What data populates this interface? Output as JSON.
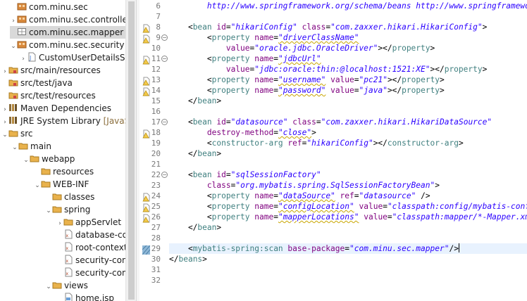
{
  "explorer": {
    "items": [
      {
        "indent": 12,
        "twisty": "",
        "icon": "package-icon",
        "label": "com.minu.sec",
        "extra": "",
        "selected": false
      },
      {
        "indent": 12,
        "twisty": "›",
        "icon": "package-icon",
        "label": "com.minu.sec.controller",
        "extra": "",
        "selected": false
      },
      {
        "indent": 12,
        "twisty": "",
        "icon": "empty-package-icon",
        "label": "com.minu.sec.mapper",
        "extra": "",
        "selected": true
      },
      {
        "indent": 12,
        "twisty": "⌄",
        "icon": "package-icon",
        "label": "com.minu.sec.security",
        "extra": "",
        "selected": false
      },
      {
        "indent": 26,
        "twisty": "›",
        "icon": "java-file-icon",
        "label": "CustomUserDetailsSe",
        "extra": "",
        "selected": false
      },
      {
        "indent": 0,
        "twisty": "›",
        "icon": "source-folder-icon",
        "label": "src/main/resources",
        "extra": "",
        "selected": false
      },
      {
        "indent": 0,
        "twisty": "",
        "icon": "source-folder-icon",
        "label": "src/test/java",
        "extra": "",
        "selected": false
      },
      {
        "indent": 0,
        "twisty": "",
        "icon": "source-folder-icon",
        "label": "src/test/resources",
        "extra": "",
        "selected": false
      },
      {
        "indent": 0,
        "twisty": "›",
        "icon": "library-icon",
        "label": "Maven Dependencies",
        "extra": "",
        "selected": false
      },
      {
        "indent": 0,
        "twisty": "›",
        "icon": "library-icon",
        "label": "JRE System Library",
        "extra": "[JavaSE-",
        "selected": false
      },
      {
        "indent": 0,
        "twisty": "⌄",
        "icon": "folder-icon",
        "label": "src",
        "extra": "",
        "selected": false
      },
      {
        "indent": 14,
        "twisty": "⌄",
        "icon": "folder-icon",
        "label": "main",
        "extra": "",
        "selected": false
      },
      {
        "indent": 30,
        "twisty": "⌄",
        "icon": "folder-icon",
        "label": "webapp",
        "extra": "",
        "selected": false
      },
      {
        "indent": 46,
        "twisty": "",
        "icon": "folder-icon",
        "label": "resources",
        "extra": "",
        "selected": false
      },
      {
        "indent": 46,
        "twisty": "⌄",
        "icon": "folder-icon",
        "label": "WEB-INF",
        "extra": "",
        "selected": false
      },
      {
        "indent": 62,
        "twisty": "",
        "icon": "folder-icon",
        "label": "classes",
        "extra": "",
        "selected": false
      },
      {
        "indent": 62,
        "twisty": "⌄",
        "icon": "folder-icon",
        "label": "spring",
        "extra": "",
        "selected": false
      },
      {
        "indent": 78,
        "twisty": "›",
        "icon": "folder-icon",
        "label": "appServlet",
        "extra": "",
        "selected": false
      },
      {
        "indent": 78,
        "twisty": "",
        "icon": "xml-file-icon",
        "label": "database-co",
        "extra": "",
        "selected": false
      },
      {
        "indent": 78,
        "twisty": "",
        "icon": "xml-file-icon",
        "label": "root-context",
        "extra": "",
        "selected": false
      },
      {
        "indent": 78,
        "twisty": "",
        "icon": "xml-file-icon",
        "label": "security-con",
        "extra": "",
        "selected": false
      },
      {
        "indent": 78,
        "twisty": "",
        "icon": "xml-file-icon",
        "label": "security-con",
        "extra": "",
        "selected": false
      },
      {
        "indent": 62,
        "twisty": "⌄",
        "icon": "folder-icon",
        "label": "views",
        "extra": "",
        "selected": false
      },
      {
        "indent": 78,
        "twisty": "",
        "icon": "jsp-file-icon",
        "label": "home.jsp",
        "extra": "",
        "selected": false
      }
    ]
  },
  "editor": {
    "lines": [
      {
        "n": "6",
        "marker": "",
        "fold": false,
        "hl": false,
        "tokens": [
          [
            "p",
            "        "
          ],
          [
            "v",
            "http://www.springframework.org/schema/beans http://www.springframework.org/schema/beans/spring-beans.xsd\">"
          ]
        ]
      },
      {
        "n": "7",
        "marker": "",
        "fold": false,
        "hl": false,
        "tokens": []
      },
      {
        "n": "8",
        "marker": "warning",
        "fold": false,
        "hl": false,
        "tokens": [
          [
            "p",
            "    <"
          ],
          [
            "t",
            "bean"
          ],
          [
            "p",
            " "
          ],
          [
            "a",
            "id"
          ],
          [
            "p",
            "="
          ],
          [
            "v",
            "\"hikariConfig\""
          ],
          [
            "p",
            " "
          ],
          [
            "a",
            "class"
          ],
          [
            "p",
            "="
          ],
          [
            "v",
            "\"com.zaxxer.hikari.HikariConfig\""
          ],
          [
            "p",
            ">"
          ]
        ]
      },
      {
        "n": "9",
        "marker": "warning",
        "fold": true,
        "hl": false,
        "tokens": [
          [
            "p",
            "        <"
          ],
          [
            "t",
            "property"
          ],
          [
            "p",
            " "
          ],
          [
            "a",
            "name"
          ],
          [
            "p",
            "="
          ],
          [
            "vs",
            "\"driverClassName\""
          ]
        ]
      },
      {
        "n": "10",
        "marker": "",
        "fold": false,
        "hl": false,
        "tokens": [
          [
            "p",
            "            "
          ],
          [
            "a",
            "value"
          ],
          [
            "p",
            "="
          ],
          [
            "v",
            "\"oracle.jdbc.OracleDriver\""
          ],
          [
            "p",
            "></"
          ],
          [
            "t",
            "property"
          ],
          [
            "p",
            ">"
          ]
        ]
      },
      {
        "n": "11",
        "marker": "warning",
        "fold": true,
        "hl": false,
        "tokens": [
          [
            "p",
            "        <"
          ],
          [
            "t",
            "property"
          ],
          [
            "p",
            " "
          ],
          [
            "a",
            "name"
          ],
          [
            "p",
            "="
          ],
          [
            "vs",
            "\"jdbcUrl\""
          ]
        ]
      },
      {
        "n": "12",
        "marker": "",
        "fold": false,
        "hl": false,
        "tokens": [
          [
            "p",
            "            "
          ],
          [
            "a",
            "value"
          ],
          [
            "p",
            "="
          ],
          [
            "v",
            "\"jdbc:oracle:thin:@localhost:1521:XE\""
          ],
          [
            "p",
            "></"
          ],
          [
            "t",
            "property"
          ],
          [
            "p",
            ">"
          ]
        ]
      },
      {
        "n": "13",
        "marker": "warning",
        "fold": false,
        "hl": false,
        "tokens": [
          [
            "p",
            "        <"
          ],
          [
            "t",
            "property"
          ],
          [
            "p",
            " "
          ],
          [
            "a",
            "name"
          ],
          [
            "p",
            "="
          ],
          [
            "vs",
            "\"username\""
          ],
          [
            "p",
            " "
          ],
          [
            "a",
            "value"
          ],
          [
            "p",
            "="
          ],
          [
            "v",
            "\"pc21\""
          ],
          [
            "p",
            "></"
          ],
          [
            "t",
            "property"
          ],
          [
            "p",
            ">"
          ]
        ]
      },
      {
        "n": "14",
        "marker": "warning",
        "fold": false,
        "hl": false,
        "tokens": [
          [
            "p",
            "        <"
          ],
          [
            "t",
            "property"
          ],
          [
            "p",
            " "
          ],
          [
            "a",
            "name"
          ],
          [
            "p",
            "="
          ],
          [
            "vs",
            "\"password\""
          ],
          [
            "p",
            " "
          ],
          [
            "a",
            "value"
          ],
          [
            "p",
            "="
          ],
          [
            "v",
            "\"java\""
          ],
          [
            "p",
            "></"
          ],
          [
            "t",
            "property"
          ],
          [
            "p",
            ">"
          ]
        ]
      },
      {
        "n": "15",
        "marker": "",
        "fold": false,
        "hl": false,
        "tokens": [
          [
            "p",
            "    </"
          ],
          [
            "t",
            "bean"
          ],
          [
            "p",
            ">"
          ]
        ]
      },
      {
        "n": "16",
        "marker": "",
        "fold": false,
        "hl": false,
        "tokens": []
      },
      {
        "n": "17",
        "marker": "",
        "fold": true,
        "hl": false,
        "tokens": [
          [
            "p",
            "    <"
          ],
          [
            "t",
            "bean"
          ],
          [
            "p",
            " "
          ],
          [
            "a",
            "id"
          ],
          [
            "p",
            "="
          ],
          [
            "v",
            "\"datasource\""
          ],
          [
            "p",
            " "
          ],
          [
            "a",
            "class"
          ],
          [
            "p",
            "="
          ],
          [
            "v",
            "\"com.zaxxer.hikari.HikariDataSource\""
          ]
        ]
      },
      {
        "n": "18",
        "marker": "warning",
        "fold": false,
        "hl": false,
        "tokens": [
          [
            "p",
            "        "
          ],
          [
            "a",
            "destroy-method"
          ],
          [
            "p",
            "="
          ],
          [
            "vs",
            "\"close\""
          ],
          [
            "p",
            ">"
          ]
        ]
      },
      {
        "n": "19",
        "marker": "",
        "fold": false,
        "hl": false,
        "tokens": [
          [
            "p",
            "        <"
          ],
          [
            "t",
            "constructor-arg"
          ],
          [
            "p",
            " "
          ],
          [
            "a",
            "ref"
          ],
          [
            "p",
            "="
          ],
          [
            "v",
            "\"hikariConfig\""
          ],
          [
            "p",
            "></"
          ],
          [
            "t",
            "constructor-arg"
          ],
          [
            "p",
            ">"
          ]
        ]
      },
      {
        "n": "20",
        "marker": "",
        "fold": false,
        "hl": false,
        "tokens": [
          [
            "p",
            "    </"
          ],
          [
            "t",
            "bean"
          ],
          [
            "p",
            ">"
          ]
        ]
      },
      {
        "n": "21",
        "marker": "",
        "fold": false,
        "hl": false,
        "tokens": []
      },
      {
        "n": "22",
        "marker": "",
        "fold": true,
        "hl": false,
        "tokens": [
          [
            "p",
            "    <"
          ],
          [
            "t",
            "bean"
          ],
          [
            "p",
            " "
          ],
          [
            "a",
            "id"
          ],
          [
            "p",
            "="
          ],
          [
            "v",
            "\"sqlSessionFactory\""
          ]
        ]
      },
      {
        "n": "23",
        "marker": "",
        "fold": false,
        "hl": false,
        "tokens": [
          [
            "p",
            "        "
          ],
          [
            "a",
            "class"
          ],
          [
            "p",
            "="
          ],
          [
            "v",
            "\"org.mybatis.spring.SqlSessionFactoryBean\""
          ],
          [
            "p",
            ">"
          ]
        ]
      },
      {
        "n": "24",
        "marker": "warning",
        "fold": false,
        "hl": false,
        "tokens": [
          [
            "p",
            "        <"
          ],
          [
            "t",
            "property"
          ],
          [
            "p",
            " "
          ],
          [
            "a",
            "name"
          ],
          [
            "p",
            "="
          ],
          [
            "vs",
            "\"dataSource\""
          ],
          [
            "p",
            " "
          ],
          [
            "a",
            "ref"
          ],
          [
            "p",
            "="
          ],
          [
            "v",
            "\"datasource\""
          ],
          [
            "p",
            " />"
          ]
        ]
      },
      {
        "n": "25",
        "marker": "warning",
        "fold": false,
        "hl": false,
        "tokens": [
          [
            "p",
            "        <"
          ],
          [
            "t",
            "property"
          ],
          [
            "p",
            " "
          ],
          [
            "a",
            "name"
          ],
          [
            "p",
            "="
          ],
          [
            "vs",
            "\"configLocation\""
          ],
          [
            "p",
            " "
          ],
          [
            "a",
            "value"
          ],
          [
            "p",
            "="
          ],
          [
            "v",
            "\"classpath:config/mybatis-config.xml\""
          ],
          [
            "p",
            "/>"
          ]
        ]
      },
      {
        "n": "26",
        "marker": "warning",
        "fold": false,
        "hl": false,
        "tokens": [
          [
            "p",
            "        <"
          ],
          [
            "t",
            "property"
          ],
          [
            "p",
            " "
          ],
          [
            "a",
            "name"
          ],
          [
            "p",
            "="
          ],
          [
            "vs",
            "\"mapperLocations\""
          ],
          [
            "p",
            " "
          ],
          [
            "a",
            "value"
          ],
          [
            "p",
            "="
          ],
          [
            "v",
            "\"classpath:mapper/*-Mapper.xml\""
          ],
          [
            "p",
            "/>"
          ]
        ]
      },
      {
        "n": "27",
        "marker": "",
        "fold": false,
        "hl": false,
        "tokens": [
          [
            "p",
            "    </"
          ],
          [
            "t",
            "bean"
          ],
          [
            "p",
            ">"
          ]
        ]
      },
      {
        "n": "28",
        "marker": "",
        "fold": false,
        "hl": false,
        "tokens": []
      },
      {
        "n": "29",
        "marker": "change",
        "fold": false,
        "hl": true,
        "tokens": [
          [
            "p",
            "    <"
          ],
          [
            "t",
            "mybatis-spring:scan"
          ],
          [
            "p",
            " "
          ],
          [
            "a",
            "base-package"
          ],
          [
            "p",
            "="
          ],
          [
            "v",
            "\"com.minu.sec.mapper\""
          ],
          [
            "p",
            "/>"
          ],
          [
            "caret",
            ""
          ]
        ]
      },
      {
        "n": "30",
        "marker": "",
        "fold": false,
        "hl": false,
        "tokens": [
          [
            "p",
            "</"
          ],
          [
            "t",
            "beans"
          ],
          [
            "p",
            ">"
          ]
        ]
      },
      {
        "n": "31",
        "marker": "",
        "fold": false,
        "hl": false,
        "tokens": []
      },
      {
        "n": "32",
        "marker": "",
        "fold": false,
        "hl": false,
        "tokens": []
      }
    ]
  }
}
